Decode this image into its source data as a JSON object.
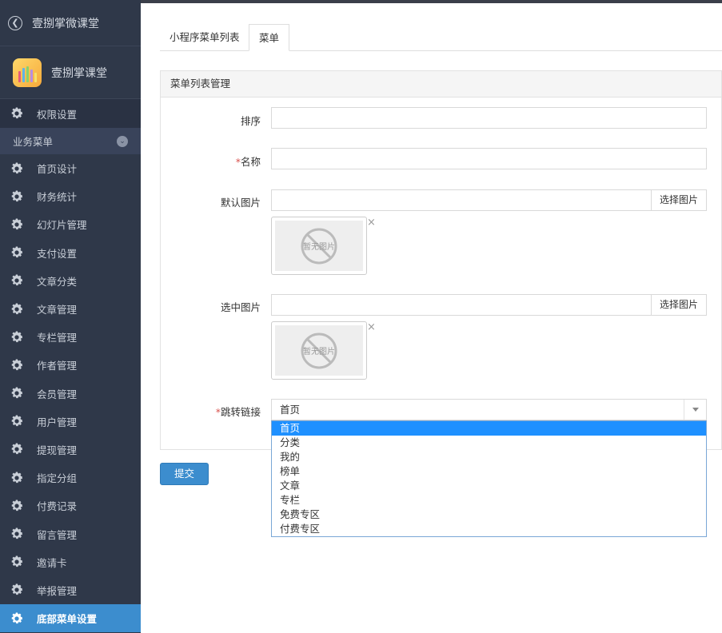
{
  "sidebar": {
    "app_title": "壹捌掌微课堂",
    "brand_name": "壹捌掌课堂",
    "permission_label": "权限设置",
    "group_label": "业务菜单",
    "items": [
      {
        "label": "首页设计"
      },
      {
        "label": "财务统计"
      },
      {
        "label": "幻灯片管理"
      },
      {
        "label": "支付设置"
      },
      {
        "label": "文章分类"
      },
      {
        "label": "文章管理"
      },
      {
        "label": "专栏管理"
      },
      {
        "label": "作者管理"
      },
      {
        "label": "会员管理"
      },
      {
        "label": "用户管理"
      },
      {
        "label": "提现管理"
      },
      {
        "label": "指定分组"
      },
      {
        "label": "付费记录"
      },
      {
        "label": "留言管理"
      },
      {
        "label": "邀请卡"
      },
      {
        "label": "举报管理"
      },
      {
        "label": "底部菜单设置"
      }
    ]
  },
  "tabs": {
    "list_tab": "小程序菜单列表",
    "menu_tab": "菜单"
  },
  "panel": {
    "title": "菜单列表管理",
    "sort_label": "排序",
    "sort_value": "",
    "name_required": "*",
    "name_label": "名称",
    "name_value": "",
    "default_image_label": "默认图片",
    "default_image_value": "",
    "selected_image_label": "选中图片",
    "selected_image_value": "",
    "choose_image_button": "选择图片",
    "no_image_text": "暂无图片",
    "remove_symbol": "×",
    "link_required": "*",
    "link_label": "跳转链接",
    "link_value": "首页"
  },
  "dropdown": {
    "options": [
      "首页",
      "分类",
      "我的",
      "榜单",
      "文章",
      "专栏",
      "免费专区",
      "付费专区"
    ],
    "selected_index": 0
  },
  "submit_label": "提交",
  "colors": {
    "sidebar_bg": "#2f3849",
    "accent": "#3c8dce",
    "selected_option": "#1e90ff",
    "required": "#d9534f"
  }
}
